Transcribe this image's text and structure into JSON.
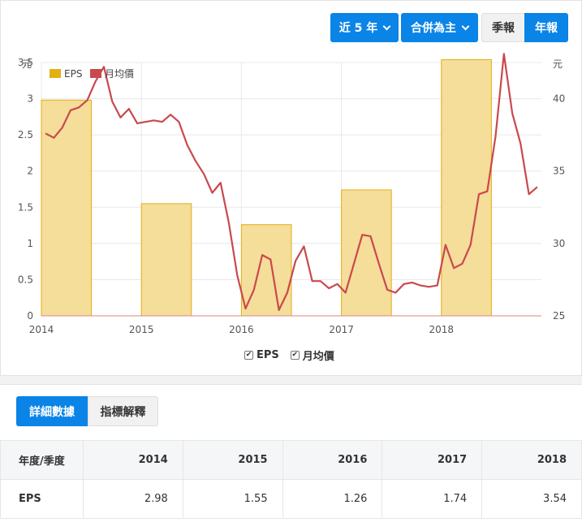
{
  "controls": {
    "period_label": "近 5 年",
    "scope_label": "合併為主",
    "quarterly_label": "季報",
    "annual_label": "年報"
  },
  "colors": {
    "eps_fill": "#f5dd9a",
    "eps_border": "#e2b010",
    "price_line": "#c9494d",
    "accent": "#0a84e6"
  },
  "chart_data": {
    "type": "bar",
    "left_axis_unit": "元",
    "right_axis_unit": "元",
    "x_ticks": [
      "2014",
      "2015",
      "2016",
      "2017",
      "2018"
    ],
    "left_ticks": [
      "0",
      "0.5",
      "1",
      "1.5",
      "2",
      "2.5",
      "3",
      "3.5"
    ],
    "right_ticks": [
      "25",
      "30",
      "35",
      "40"
    ],
    "ylim_left": [
      0,
      3.5
    ],
    "ylim_right": [
      25,
      42.5
    ],
    "legend_position": "top-left",
    "series": [
      {
        "name": "EPS",
        "type": "bar",
        "axis": "left",
        "x": [
          2014,
          2015,
          2016,
          2017,
          2018
        ],
        "values": [
          2.98,
          1.55,
          1.26,
          1.74,
          3.54
        ]
      },
      {
        "name": "月均價",
        "type": "line",
        "axis": "right",
        "x": [
          2014.0,
          2014.0833,
          2014.1667,
          2014.25,
          2014.3333,
          2014.4167,
          2014.5,
          2014.5833,
          2014.6667,
          2014.75,
          2014.8333,
          2014.9167,
          2015.0,
          2015.0833,
          2015.1667,
          2015.25,
          2015.3333,
          2015.4167,
          2015.5,
          2015.5833,
          2015.6667,
          2015.75,
          2015.8333,
          2015.9167,
          2016.0,
          2016.0833,
          2016.1667,
          2016.25,
          2016.3333,
          2016.4167,
          2016.5,
          2016.5833,
          2016.6667,
          2016.75,
          2016.8333,
          2016.9167,
          2017.0,
          2017.0833,
          2017.1667,
          2017.25,
          2017.3333,
          2017.4167,
          2017.5,
          2017.5833,
          2017.6667,
          2017.75,
          2017.8333,
          2017.9167,
          2018.0,
          2018.0833,
          2018.1667,
          2018.25,
          2018.3333,
          2018.4167,
          2018.5,
          2018.5833,
          2018.6667,
          2018.75,
          2018.8333,
          2018.9167
        ],
        "values": [
          37.6,
          37.3,
          38.0,
          39.2,
          39.4,
          39.9,
          41.2,
          42.2,
          39.8,
          38.7,
          39.3,
          38.3,
          38.4,
          38.5,
          38.4,
          38.9,
          38.4,
          36.8,
          35.7,
          34.8,
          33.5,
          34.2,
          31.4,
          27.8,
          25.5,
          26.8,
          29.2,
          28.9,
          25.4,
          26.6,
          28.8,
          29.8,
          27.4,
          27.4,
          26.9,
          27.2,
          26.6,
          28.6,
          30.6,
          30.5,
          28.6,
          26.8,
          26.6,
          27.2,
          27.3,
          27.1,
          27.0,
          27.1,
          29.9,
          28.3,
          28.6,
          29.9,
          33.4,
          33.6,
          37.4,
          43.1,
          39.0,
          36.9,
          33.4,
          33.9
        ]
      }
    ]
  },
  "legend_toggles": {
    "eps": "EPS",
    "price": "月均價"
  },
  "detail_tabs": {
    "details": "詳細數據",
    "explain": "指標解釋"
  },
  "table": {
    "header_label": "年度/季度",
    "years": [
      "2014",
      "2015",
      "2016",
      "2017",
      "2018"
    ],
    "row_label": "EPS",
    "eps_values": [
      "2.98",
      "1.55",
      "1.26",
      "1.74",
      "3.54"
    ]
  }
}
